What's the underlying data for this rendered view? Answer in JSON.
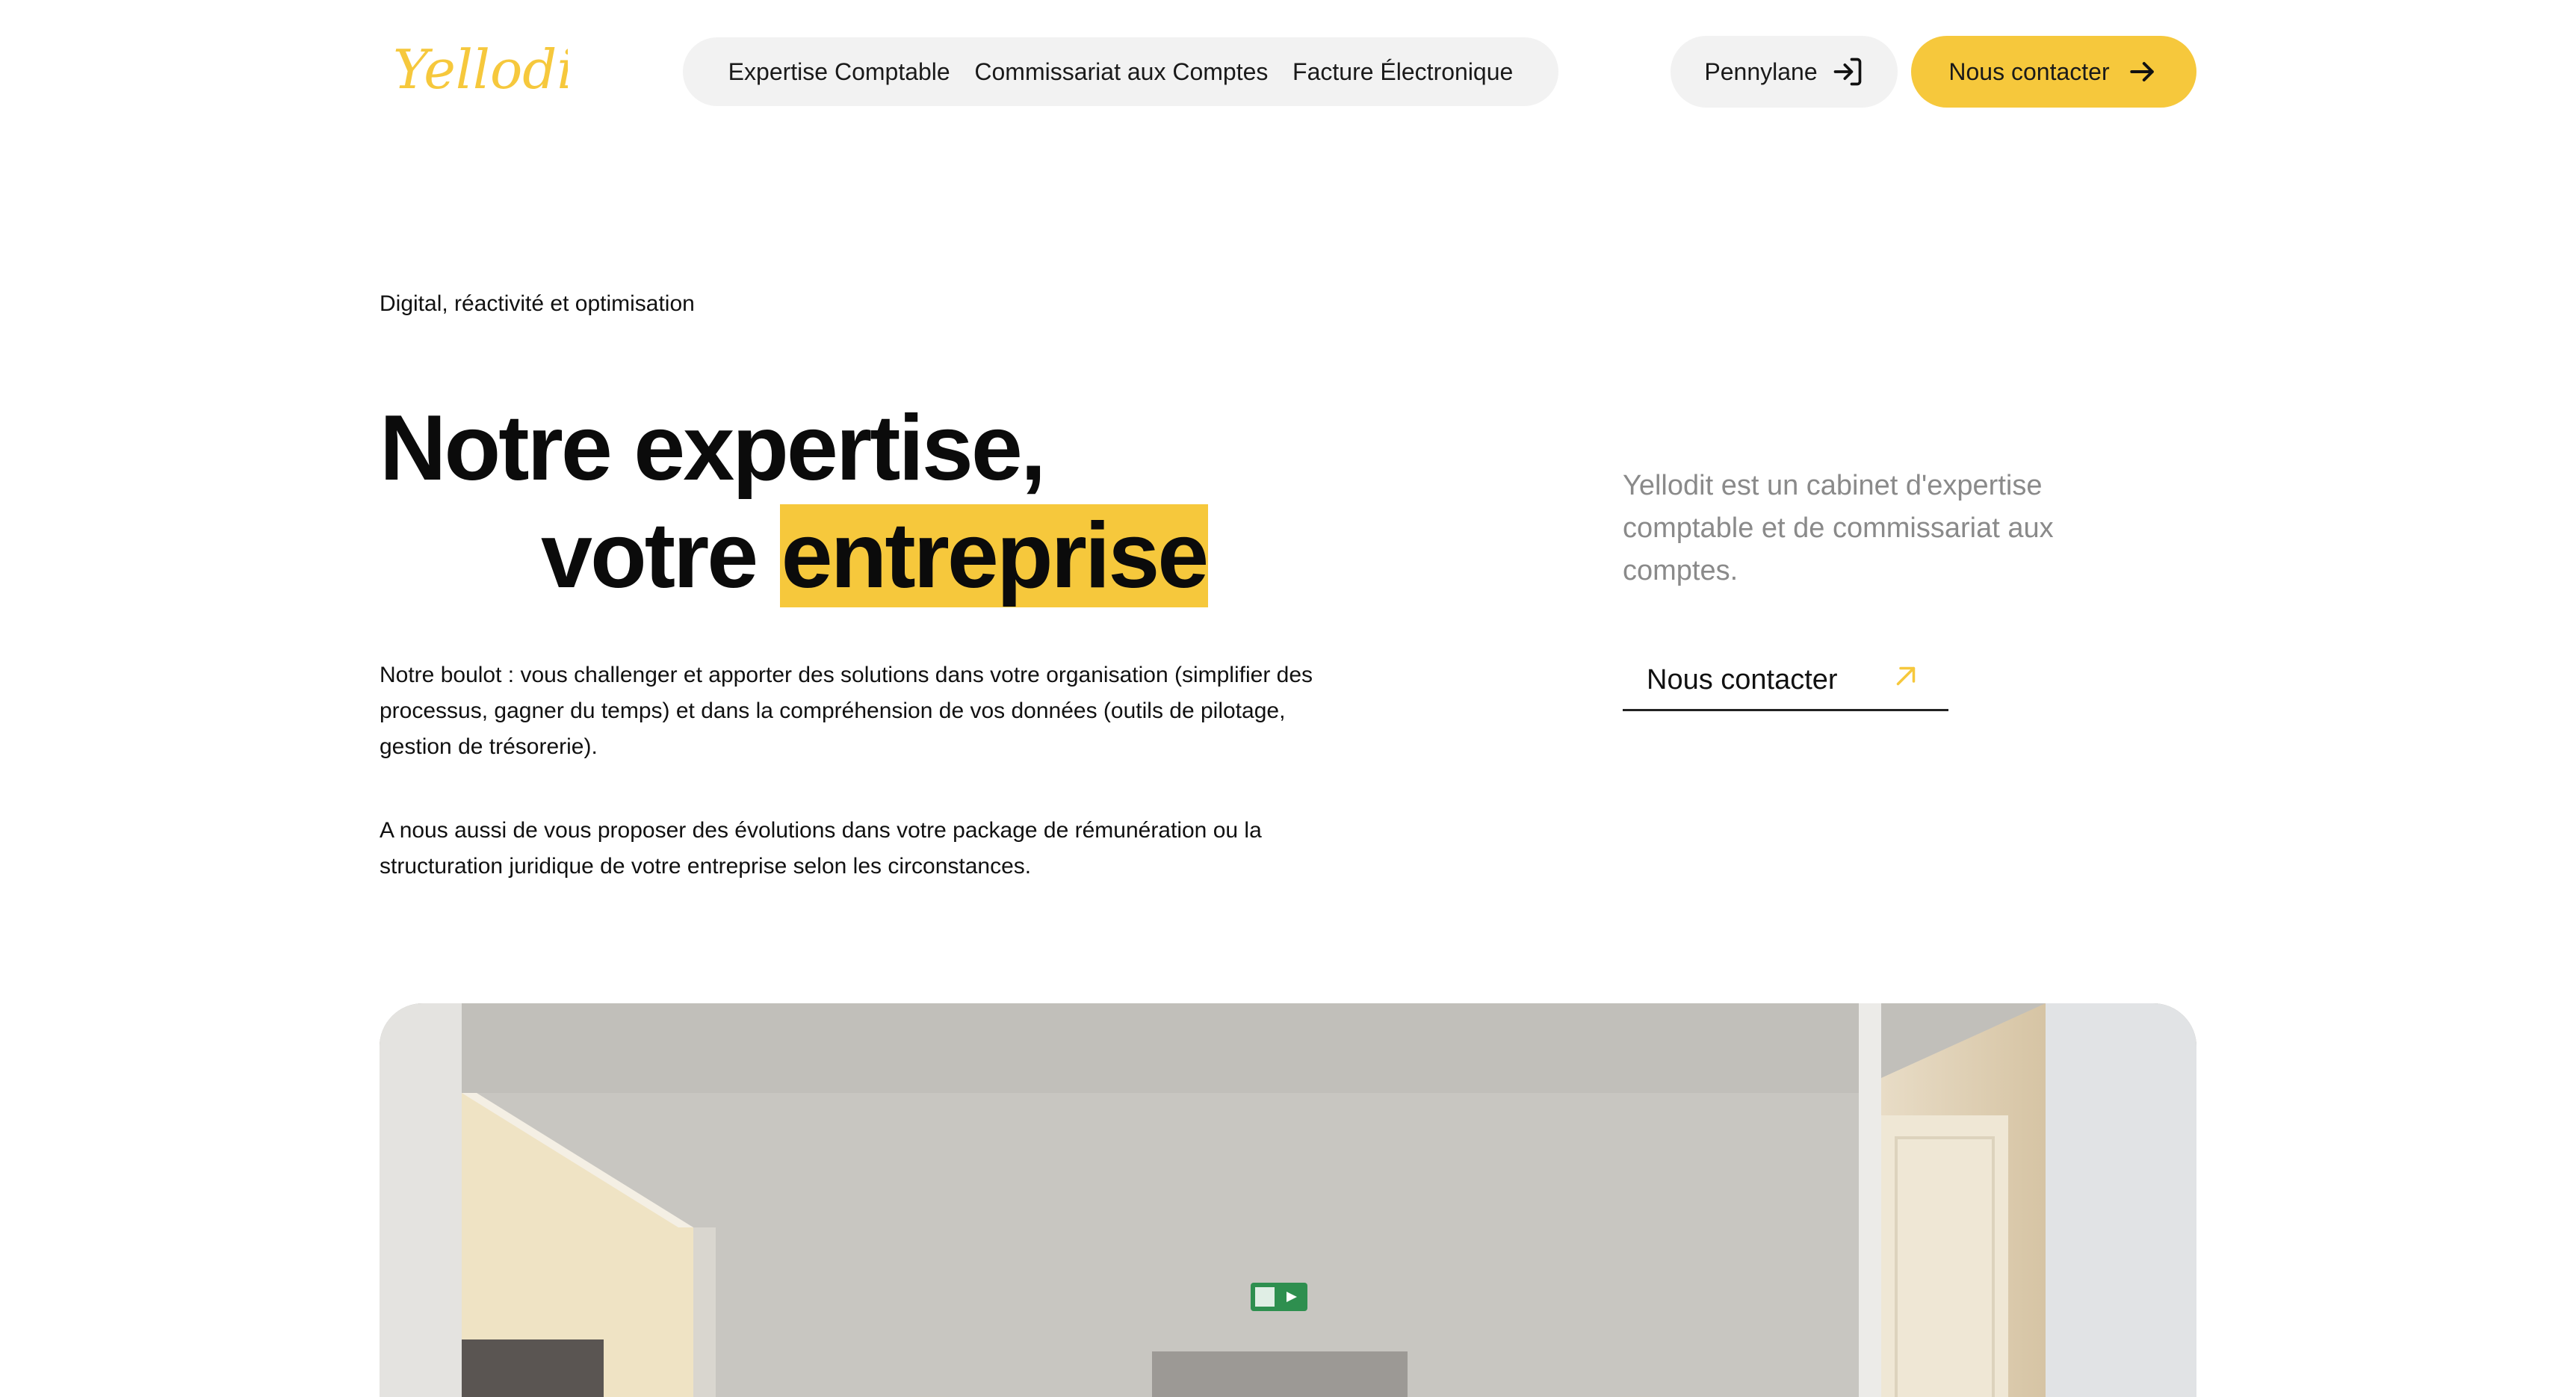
{
  "brand": {
    "logo_text": "Yellodit.",
    "accent_color": "#f6c83c"
  },
  "nav": {
    "links": [
      {
        "label": "Expertise Comptable"
      },
      {
        "label": "Commissariat aux Comptes"
      },
      {
        "label": "Facture Électronique"
      }
    ]
  },
  "header_actions": {
    "pennylane_label": "Pennylane",
    "pennylane_icon": "login-icon",
    "contact_label": "Nous contacter",
    "contact_icon": "arrow-right-icon"
  },
  "hero": {
    "eyebrow": "Digital, réactivité et optimisation",
    "headline_line1": "Notre expertise,",
    "headline_line2_prefix": "votre",
    "headline_highlight": "entreprise",
    "paragraph_1": "Notre boulot : vous challenger et apporter des solutions dans votre organisation (simplifier des processus, gagner du temps) et dans la compréhension de vos données (outils de pilotage, gestion de trésorerie).",
    "paragraph_2": "A nous aussi de vous proposer des évolutions dans votre package de rémunération ou la structuration juridique de votre entreprise selon les circonstances.",
    "side_description": "Yellodit est un cabinet d'expertise comptable et de commissariat aux comptes.",
    "side_link_label": "Nous contacter",
    "side_link_icon": "arrow-up-right-icon"
  },
  "photo": {
    "subject": "office-corridor-image",
    "sign_icon": "emergency-exit-sign-icon"
  }
}
